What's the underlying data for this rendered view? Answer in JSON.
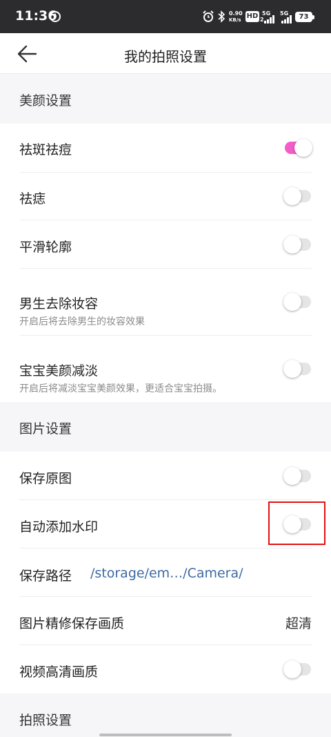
{
  "status_bar": {
    "time": "11:36",
    "net_speed_value": "0.90",
    "net_speed_unit": "KB/s",
    "hd_label": "HD",
    "hd_sub": "2",
    "net1": "5G",
    "net2": "5G",
    "battery": "73"
  },
  "header": {
    "title": "我的拍照设置"
  },
  "sections": {
    "beauty": {
      "title": "美颜设置",
      "items": [
        {
          "label": "祛斑祛痘",
          "toggle": "on"
        },
        {
          "label": "祛痣",
          "toggle": "off"
        },
        {
          "label": "平滑轮廓",
          "toggle": "off"
        },
        {
          "label": "男生去除妆容",
          "desc": "开启后将去除男生的妆容效果",
          "toggle": "off"
        },
        {
          "label": "宝宝美颜减淡",
          "desc": "开启后将减淡宝宝美颜效果，更适合宝宝拍摄。",
          "toggle": "off"
        }
      ]
    },
    "photo": {
      "title": "图片设置",
      "items": [
        {
          "label": "保存原图",
          "toggle": "off"
        },
        {
          "label": "自动添加水印",
          "toggle": "off"
        },
        {
          "label": "保存路径",
          "value": "/storage/em…/Camera/"
        },
        {
          "label": "图片精修保存画质",
          "value": "超清"
        },
        {
          "label": "视频高清画质",
          "toggle": "off"
        }
      ]
    },
    "camera": {
      "title": "拍照设置"
    }
  },
  "colors": {
    "toggle_on": "#f25dc8",
    "toggle_off_track": "#e5e5e5",
    "path_link": "#3e6aa3",
    "highlight_box": "#e01010",
    "status_bar_bg": "#2c2c2e"
  }
}
